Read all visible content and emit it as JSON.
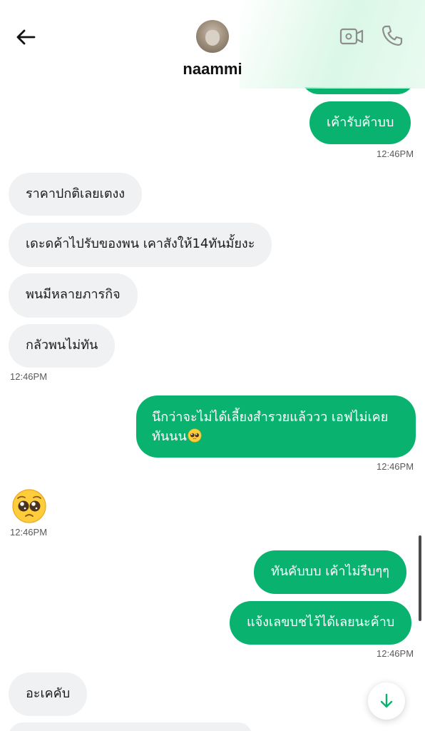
{
  "header": {
    "contact_name": "naammi",
    "icons": {
      "back": "arrow-left-icon",
      "video": "video-camera-icon",
      "call": "phone-icon",
      "avatar": "cat-photo-avatar"
    }
  },
  "messages": [
    {
      "direction": "out",
      "text": ""
    },
    {
      "direction": "out",
      "text": "เค้ารับค้าบบ"
    },
    {
      "time": "12:46PM"
    },
    {
      "direction": "in",
      "text": "ราคาปกติเลยเตงง"
    },
    {
      "direction": "in",
      "text": "เดะดค้าไปรับของพน เคาสังให้14ทันมั้ยงะ"
    },
    {
      "direction": "in",
      "text": "พนมีหลายภารกิจ"
    },
    {
      "direction": "in",
      "text": "กลัวพนไม่ทัน"
    },
    {
      "time": "12:46PM"
    },
    {
      "direction": "out",
      "text": "นึกว่าจะไม่ได้เลี้ยงสำรวยแล้ววว เอฟไม่เคย",
      "text2": "ทันนน"
    },
    {
      "time": "12:46PM"
    },
    {
      "direction": "in",
      "emoji": "pleading-face-emoji"
    },
    {
      "time": "12:46PM"
    },
    {
      "direction": "out",
      "text": "ทันคับบบ เค้าไม่รีบๆๆ"
    },
    {
      "direction": "out",
      "text": "แจ้งเลขบชไว้ได้เลยนะค้าบ"
    },
    {
      "time": "12:46PM"
    },
    {
      "direction": "in",
      "text": "อะเคคับ"
    }
  ],
  "controls": {
    "scroll_down_icon": "arrow-down-icon"
  },
  "colors": {
    "outgoing": "#09b36f",
    "incoming": "#eff1f3",
    "accent": "#09b36f"
  }
}
